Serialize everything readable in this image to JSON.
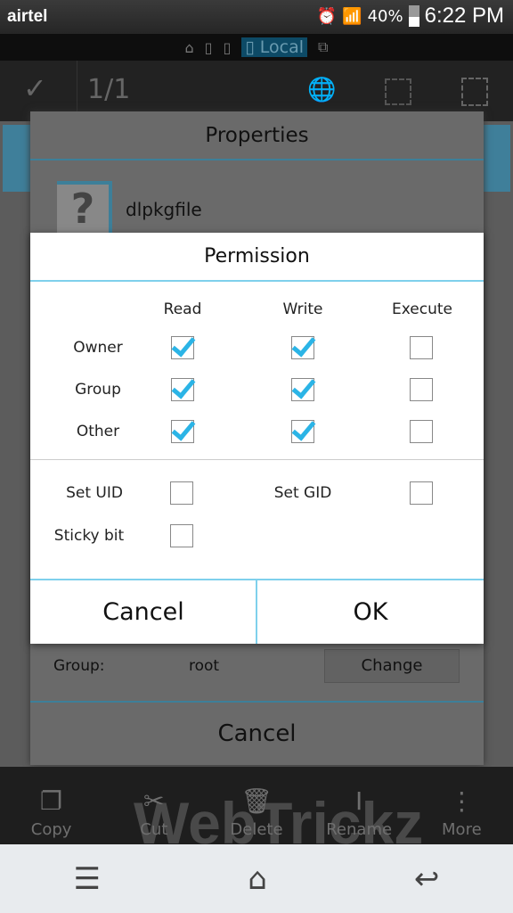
{
  "status": {
    "carrier": "airtel",
    "battery": "40%",
    "time": "6:22 PM",
    "icons": [
      "alarm-icon",
      "wifi-icon",
      "signal-icon",
      "battery-icon"
    ]
  },
  "tabs": {
    "active_label": "Local"
  },
  "actionbar": {
    "count": "1/1"
  },
  "properties": {
    "title": "Properties",
    "file_name": "dlpkgfile",
    "group_label": "Group:",
    "group_value": "root",
    "change_label": "Change",
    "cancel_label": "Cancel"
  },
  "permission": {
    "title": "Permission",
    "columns": [
      "Read",
      "Write",
      "Execute"
    ],
    "rows": [
      {
        "label": "Owner",
        "read": true,
        "write": true,
        "execute": false
      },
      {
        "label": "Group",
        "read": true,
        "write": true,
        "execute": false
      },
      {
        "label": "Other",
        "read": true,
        "write": true,
        "execute": false
      }
    ],
    "set_uid": {
      "label": "Set UID",
      "checked": false
    },
    "set_gid": {
      "label": "Set GID",
      "checked": false
    },
    "sticky": {
      "label": "Sticky bit",
      "checked": false
    },
    "cancel_label": "Cancel",
    "ok_label": "OK"
  },
  "toolbar": {
    "items": [
      {
        "label": "Copy",
        "icon": "copy-icon"
      },
      {
        "label": "Cut",
        "icon": "scissors-icon"
      },
      {
        "label": "Delete",
        "icon": "trash-icon"
      },
      {
        "label": "Rename",
        "icon": "text-cursor-icon"
      },
      {
        "label": "More",
        "icon": "more-vertical-icon"
      }
    ]
  },
  "watermark": "WebTrickz",
  "colors": {
    "accent": "#2bb4e6",
    "divider": "#7fd0ec"
  }
}
